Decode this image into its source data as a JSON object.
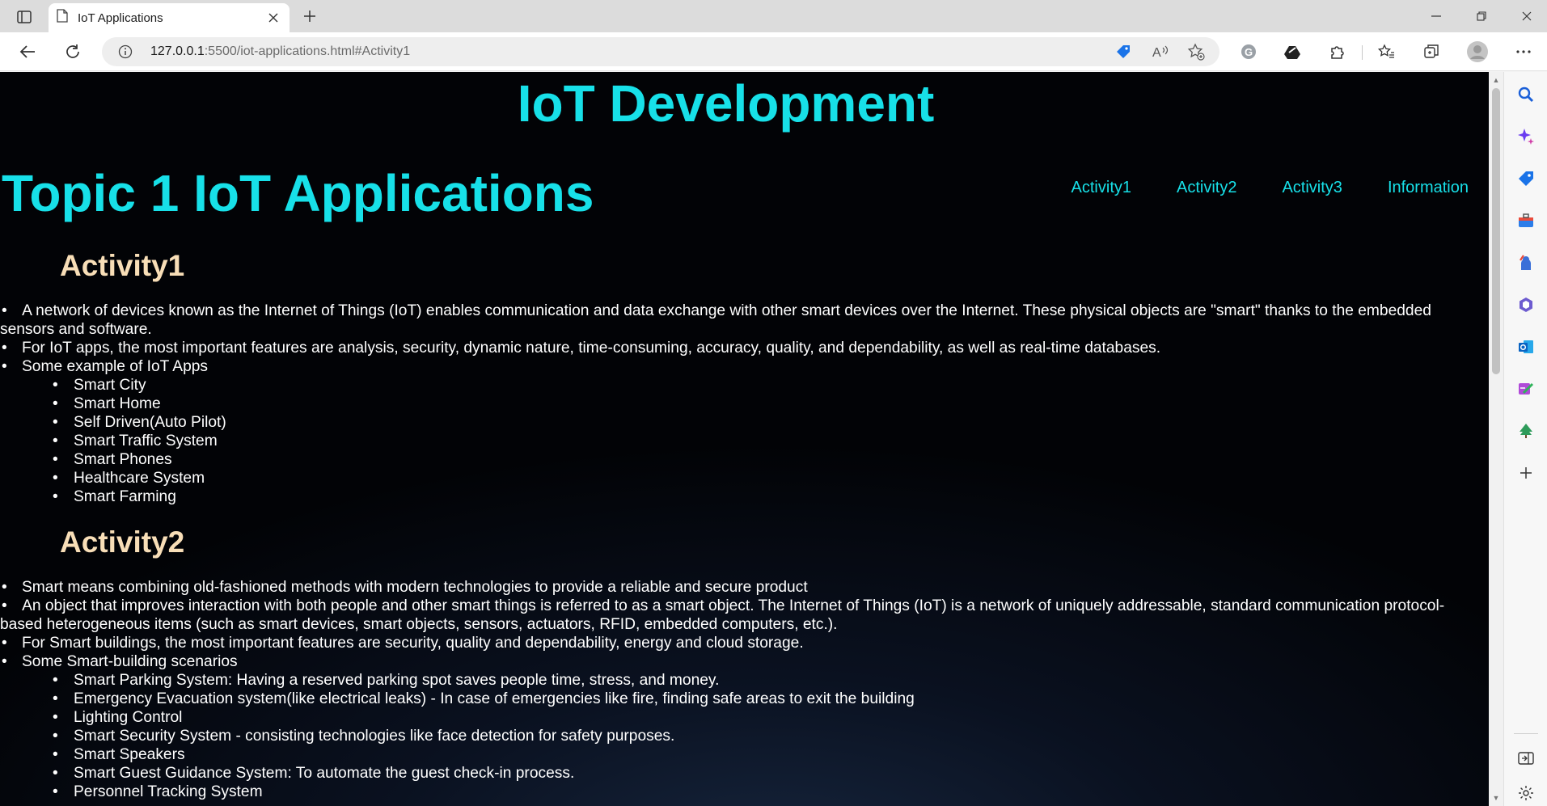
{
  "browser": {
    "tab_title": "IoT Applications",
    "url_host": "127.0.0.1",
    "url_rest": ":5500/iot-applications.html#Activity1"
  },
  "colors": {
    "accent": "#17e0e8",
    "heading": "#f8deb7",
    "background": "#020306"
  },
  "page": {
    "site_title": "IoT Development",
    "topic_title": "Topic 1 IoT Applications",
    "nav": [
      "Activity1",
      "Activity2",
      "Activity3",
      "Information"
    ],
    "activity1": {
      "heading": "Activity1",
      "item1": "A network of devices known as the Internet of Things (IoT) enables communication and data exchange with other smart devices over the Internet. These physical objects are \"smart\" thanks to the embedded sensors and software.",
      "item2": "For IoT apps, the most important features are analysis, security, dynamic nature, time-consuming, accuracy, quality, and dependability, as well as real-time databases.",
      "item3": "Some example of IoT Apps",
      "examples": [
        "Smart City",
        "Smart Home",
        "Self Driven(Auto Pilot)",
        "Smart Traffic System",
        "Smart Phones",
        "Healthcare System",
        "Smart Farming"
      ]
    },
    "activity2": {
      "heading": "Activity2",
      "item1": "Smart means combining old-fashioned methods with modern technologies to provide a reliable and secure product",
      "item2": "An object that improves interaction with both people and other smart things is referred to as a smart object. The Internet of Things (IoT) is a network of uniquely addressable, standard communication protocol-based heterogeneous items (such as smart devices, smart objects, sensors, actuators, RFID, embedded computers, etc.).",
      "item3": "For Smart buildings, the most important features are security, quality and dependability, energy and cloud storage.",
      "item4": "Some Smart-building scenarios",
      "scenarios": [
        "Smart Parking System: Having a reserved parking spot saves people time, stress, and money.",
        "Emergency Evacuation system(like electrical leaks) - In case of emergencies like fire, finding safe areas to exit the building",
        "Lighting Control",
        "Smart Security System - consisting technologies like face detection for safety purposes.",
        "Smart Speakers",
        "Smart Guest Guidance System: To automate the guest check-in process.",
        "Personnel Tracking System"
      ]
    }
  },
  "icons": {
    "toolbar": [
      "back-icon",
      "refresh-icon",
      "info-icon",
      "tag-icon",
      "read-aloud-icon",
      "favorite-add-icon",
      "copilot-icon",
      "extension-icon",
      "puzzle-icon",
      "favorites-icon",
      "collections-icon",
      "profile-icon",
      "more-icon"
    ],
    "sidebar": [
      "search-icon",
      "sparkle-icon",
      "shopping-tag-icon",
      "toolbox-icon",
      "games-icon",
      "office-icon",
      "outlook-icon",
      "designer-icon",
      "tree-icon",
      "add-icon",
      "sidebar-toggle-icon",
      "settings-icon"
    ]
  }
}
